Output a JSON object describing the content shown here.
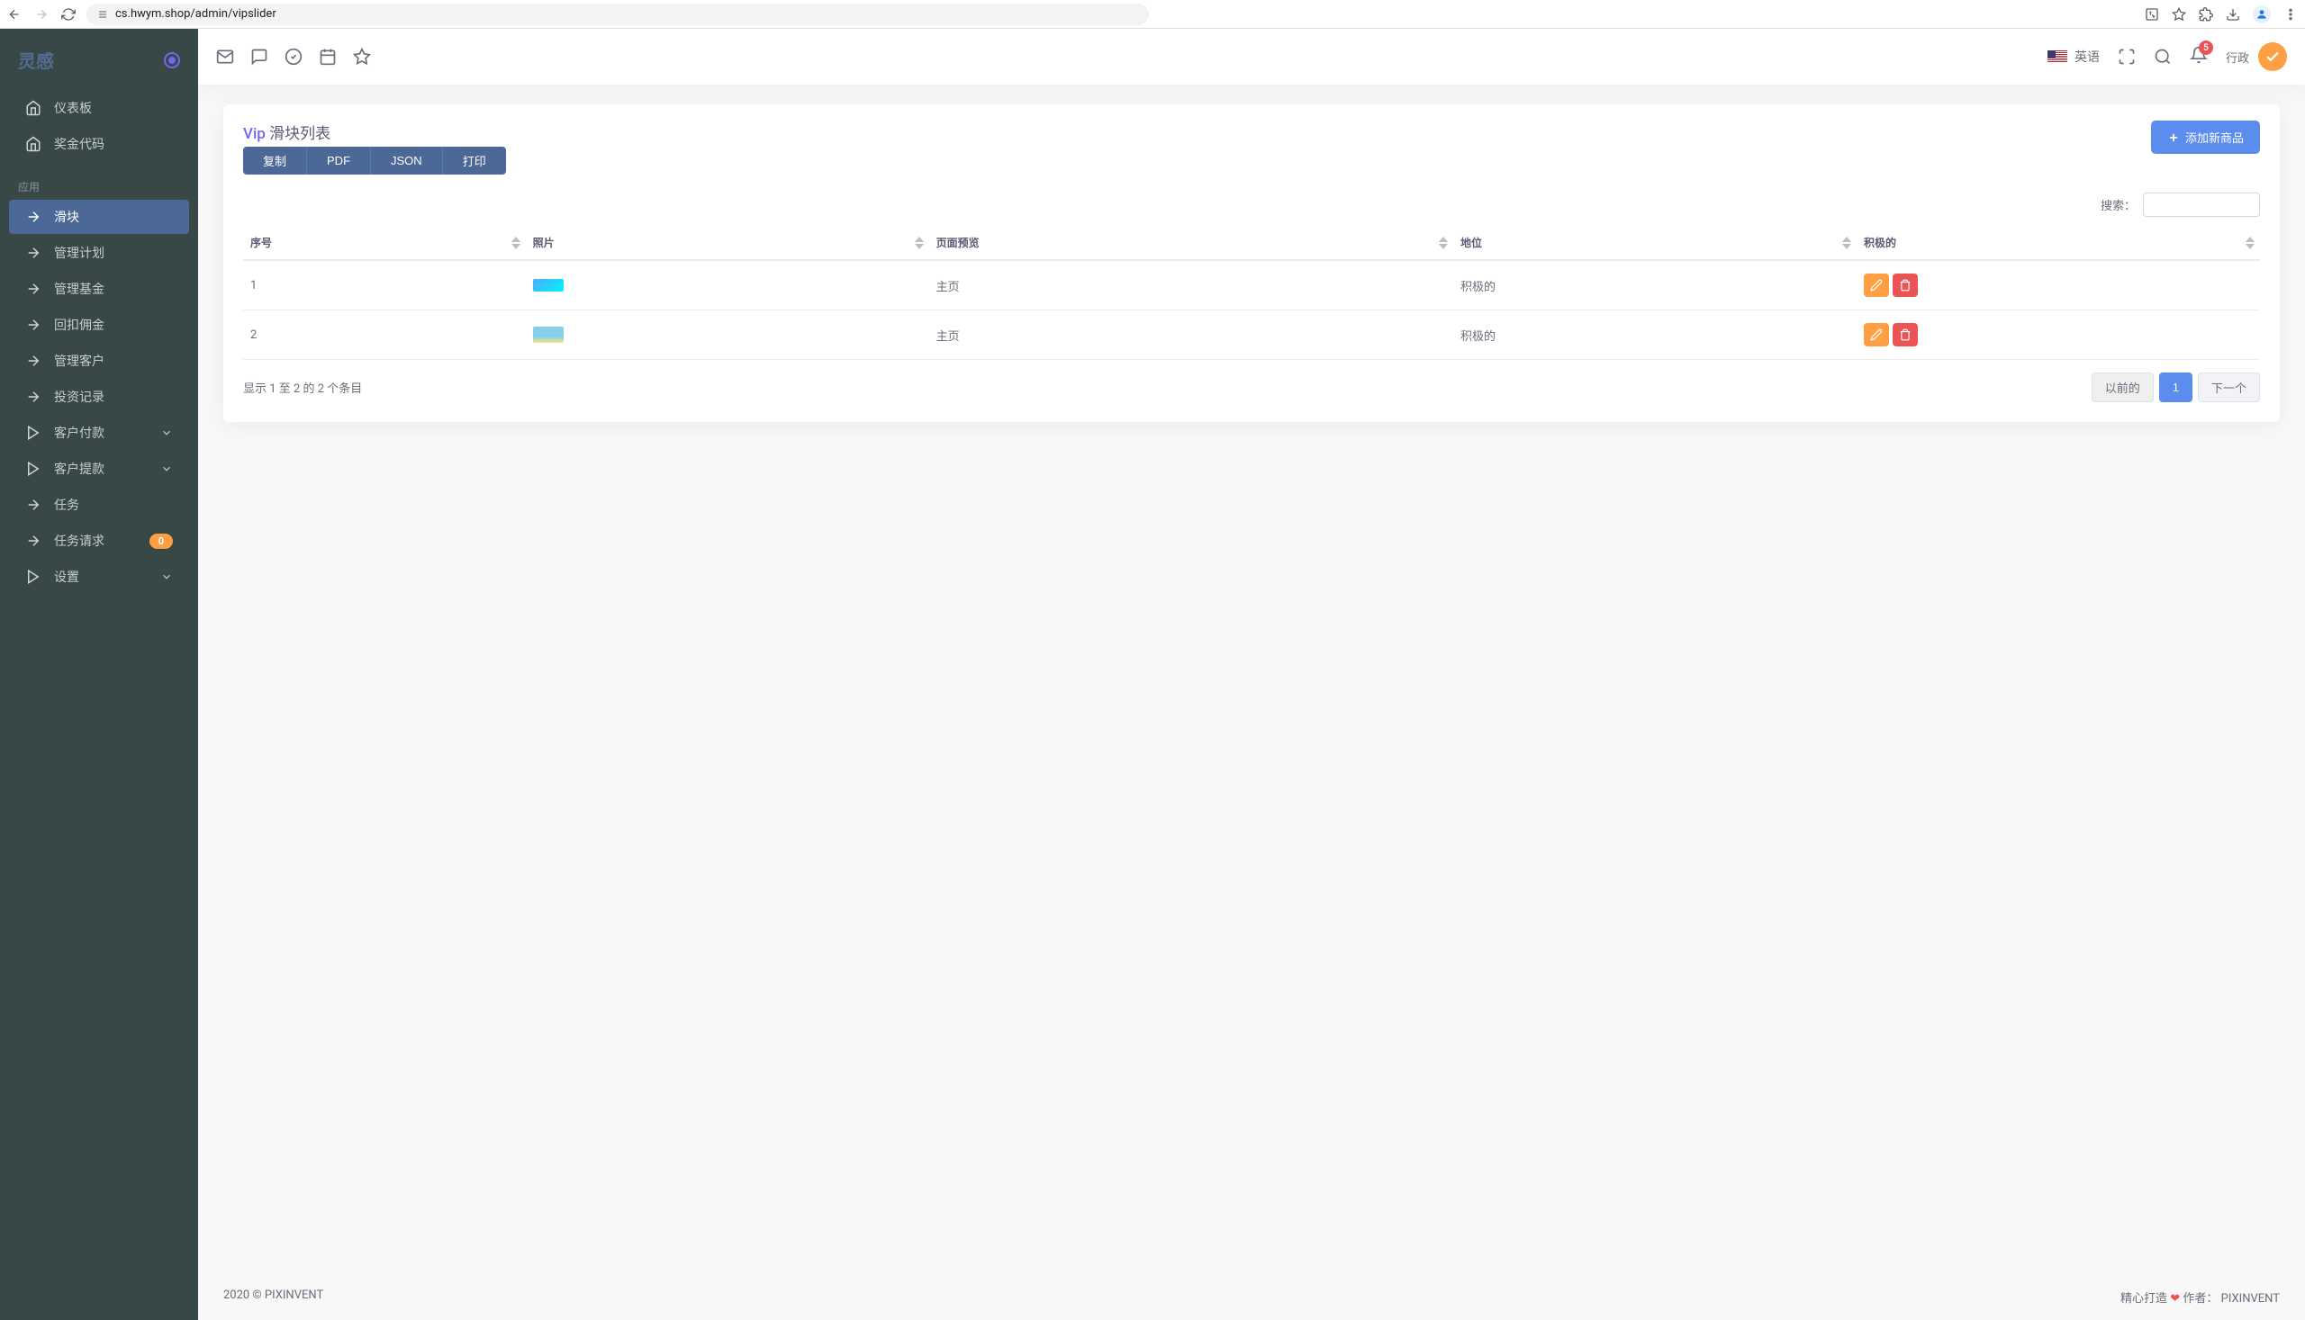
{
  "browser": {
    "url": "cs.hwym.shop/admin/vipslider"
  },
  "brand": "灵感",
  "sidebar": {
    "items": [
      {
        "label": "仪表板",
        "icon": "home"
      },
      {
        "label": "奖金代码",
        "icon": "home"
      }
    ],
    "section_label": "应用",
    "app_items": [
      {
        "label": "滑块",
        "icon": "arrow",
        "active": true
      },
      {
        "label": "管理计划",
        "icon": "arrow"
      },
      {
        "label": "管理基金",
        "icon": "arrow"
      },
      {
        "label": "回扣佣金",
        "icon": "arrow"
      },
      {
        "label": "管理客户",
        "icon": "arrow"
      },
      {
        "label": "投资记录",
        "icon": "arrow"
      },
      {
        "label": "客户付款",
        "icon": "play",
        "expandable": true
      },
      {
        "label": "客户提款",
        "icon": "play",
        "expandable": true
      },
      {
        "label": "任务",
        "icon": "arrow"
      },
      {
        "label": "任务请求",
        "icon": "arrow",
        "badge": "0"
      },
      {
        "label": "设置",
        "icon": "play",
        "expandable": true
      }
    ]
  },
  "topbar": {
    "language": "英语",
    "notifications": "5",
    "user_label": "行政"
  },
  "card": {
    "title_accent": "Vip",
    "title_rest": "滑块列表",
    "add_button": "添加新商品",
    "export_buttons": [
      "复制",
      "PDF",
      "JSON",
      "打印"
    ],
    "search_label": "搜索：",
    "columns": [
      "序号",
      "照片",
      "页面预览",
      "地位",
      "积极的"
    ],
    "rows": [
      {
        "index": "1",
        "preview": "主页",
        "status": "积极的"
      },
      {
        "index": "2",
        "preview": "主页",
        "status": "积极的"
      }
    ],
    "info": "显示 1 至 2 的 2 个条目",
    "pagination": {
      "prev": "以前的",
      "pages": [
        "1"
      ],
      "next": "下一个"
    }
  },
  "footer": {
    "left": "2020 © PIXINVENT",
    "right_made": "精心打造",
    "right_by": "作者：",
    "right_name": "PIXINVENT"
  }
}
